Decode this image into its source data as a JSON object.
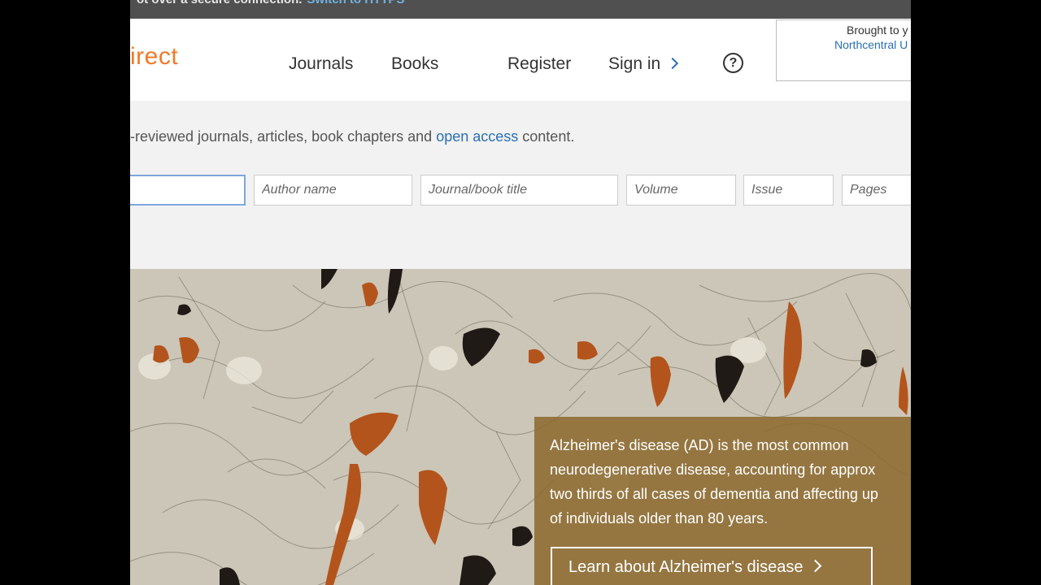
{
  "topbar": {
    "text": "ot over a secure connection.",
    "link": "Switch to HTTPS"
  },
  "header": {
    "logo": "irect",
    "nav": {
      "journals": "Journals",
      "books": "Books",
      "register": "Register",
      "sign_in": "Sign in"
    },
    "help_icon": "?",
    "institution": {
      "line1": "Brought to y",
      "line2": "Northcentral U"
    }
  },
  "search": {
    "tagline_prefix": "-reviewed journals, articles, book chapters and ",
    "tagline_link": "open access",
    "tagline_suffix": " content.",
    "fields": {
      "keywords": "",
      "author": "Author name",
      "journal": "Journal/book title",
      "volume": "Volume",
      "issue": "Issue",
      "pages": "Pages"
    }
  },
  "hero": {
    "text": "Alzheimer's disease (AD) is the most common\nneurodegenerative disease, accounting for approx\ntwo thirds of all cases of dementia and affecting up\nof individuals older than 80 years.",
    "button": "Learn about Alzheimer's disease",
    "colors": {
      "panel": "#8c692d",
      "texture": "#cfcbbd"
    }
  }
}
